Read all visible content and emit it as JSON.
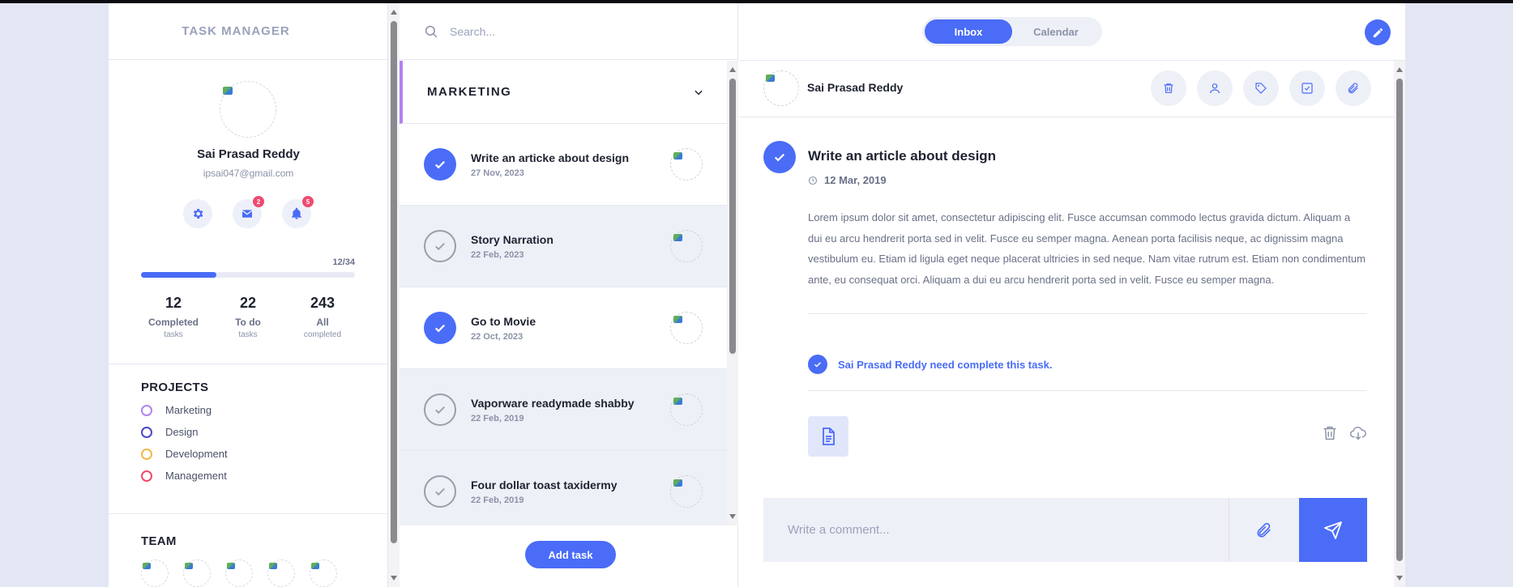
{
  "app": {
    "title": "TASK MANAGER"
  },
  "profile": {
    "name": "Sai Prasad Reddy",
    "email": "ipsai047@gmail.com",
    "icons": [
      {
        "name": "gear-icon",
        "badge": null
      },
      {
        "name": "mail-icon",
        "badge": "2"
      },
      {
        "name": "bell-icon",
        "badge": "5"
      }
    ],
    "progress_label": "12/34",
    "progress_fraction": 0.3529,
    "stats": [
      {
        "num": "12",
        "label": "Completed",
        "sub": "tasks"
      },
      {
        "num": "22",
        "label": "To do",
        "sub": "tasks"
      },
      {
        "num": "243",
        "label": "All",
        "sub": "completed"
      }
    ]
  },
  "projects": {
    "title": "PROJECTS",
    "items": [
      {
        "label": "Marketing",
        "color": "#b083f0"
      },
      {
        "label": "Design",
        "color": "#4a47c9"
      },
      {
        "label": "Development",
        "color": "#f2b84b"
      },
      {
        "label": "Management",
        "color": "#f0496f"
      }
    ]
  },
  "team": {
    "title": "TEAM"
  },
  "search": {
    "placeholder": "Search..."
  },
  "list": {
    "heading": "MARKETING",
    "tasks": [
      {
        "title": "Write an articke about design",
        "date": "27 Nov, 2023",
        "done": true
      },
      {
        "title": "Story Narration",
        "date": "22 Feb, 2023",
        "done": false
      },
      {
        "title": "Go to Movie",
        "date": "22 Oct, 2023",
        "done": true
      },
      {
        "title": "Vaporware readymade shabby",
        "date": "22 Feb, 2019",
        "done": false
      },
      {
        "title": "Four dollar toast taxidermy",
        "date": "22 Feb, 2019",
        "done": false
      }
    ],
    "add_label": "Add task"
  },
  "view_toggle": {
    "inbox": "Inbox",
    "calendar": "Calendar",
    "active": "Inbox"
  },
  "detail": {
    "user": "Sai Prasad Reddy",
    "title": "Write an article about design",
    "date": "12 Mar, 2019",
    "description": "Lorem ipsum dolor sit amet, consectetur adipiscing elit. Fusce accumsan commodo lectus gravida dictum. Aliquam a dui eu arcu hendrerit porta sed in velit. Fusce eu semper magna. Aenean porta facilisis neque, ac dignissim magna vestibulum eu. Etiam id ligula eget neque placerat ultricies in sed neque. Nam vitae rutrum est. Etiam non condimentum ante, eu consequat orci. Aliquam a dui eu arcu hendrerit porta sed in velit. Fusce eu semper magna.",
    "assign_text": "Sai Prasad Reddy need complete this task.",
    "comment_placeholder": "Write a comment..."
  },
  "colors": {
    "accent": "#4a6cf7",
    "background": "#e3e6f3",
    "badge": "#f0496f"
  }
}
